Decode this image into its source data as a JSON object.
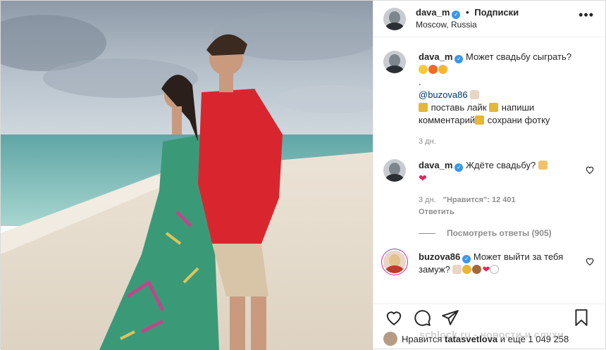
{
  "header": {
    "username": "dava_m",
    "separator": "•",
    "follow_label": "Подписки",
    "location": "Moscow, Russia",
    "more_icon": "more-horizontal-icon"
  },
  "caption": {
    "username": "dava_m",
    "text": "Может свадьбу сыграть?",
    "dot": ".",
    "mention": "@buzova86",
    "line3_a": "поставь лайк",
    "line3_b": "напиши",
    "line4_a": "комментарий",
    "line4_b": "сохрани фотку",
    "time": "3 дн."
  },
  "comments": [
    {
      "username": "dava_m",
      "text": "Ждёте свадьбу?",
      "time": "3 дн.",
      "likes": "\"Нравится\": 12 401",
      "reply": "Ответить",
      "view_replies": "Посмотреть ответы (905)"
    },
    {
      "username": "buzova86",
      "text": "Может выйти за тебя замуж?"
    }
  ],
  "likes_line": {
    "prefix": "Нравится",
    "user": "tatasvetlova",
    "suffix": "и ещё 1 049 258"
  },
  "watermark": "schlock.ru - новости и слухи",
  "colors": {
    "verified": "#3897f0",
    "text": "#262626",
    "muted": "#8e8e8e",
    "link": "#00376b"
  }
}
